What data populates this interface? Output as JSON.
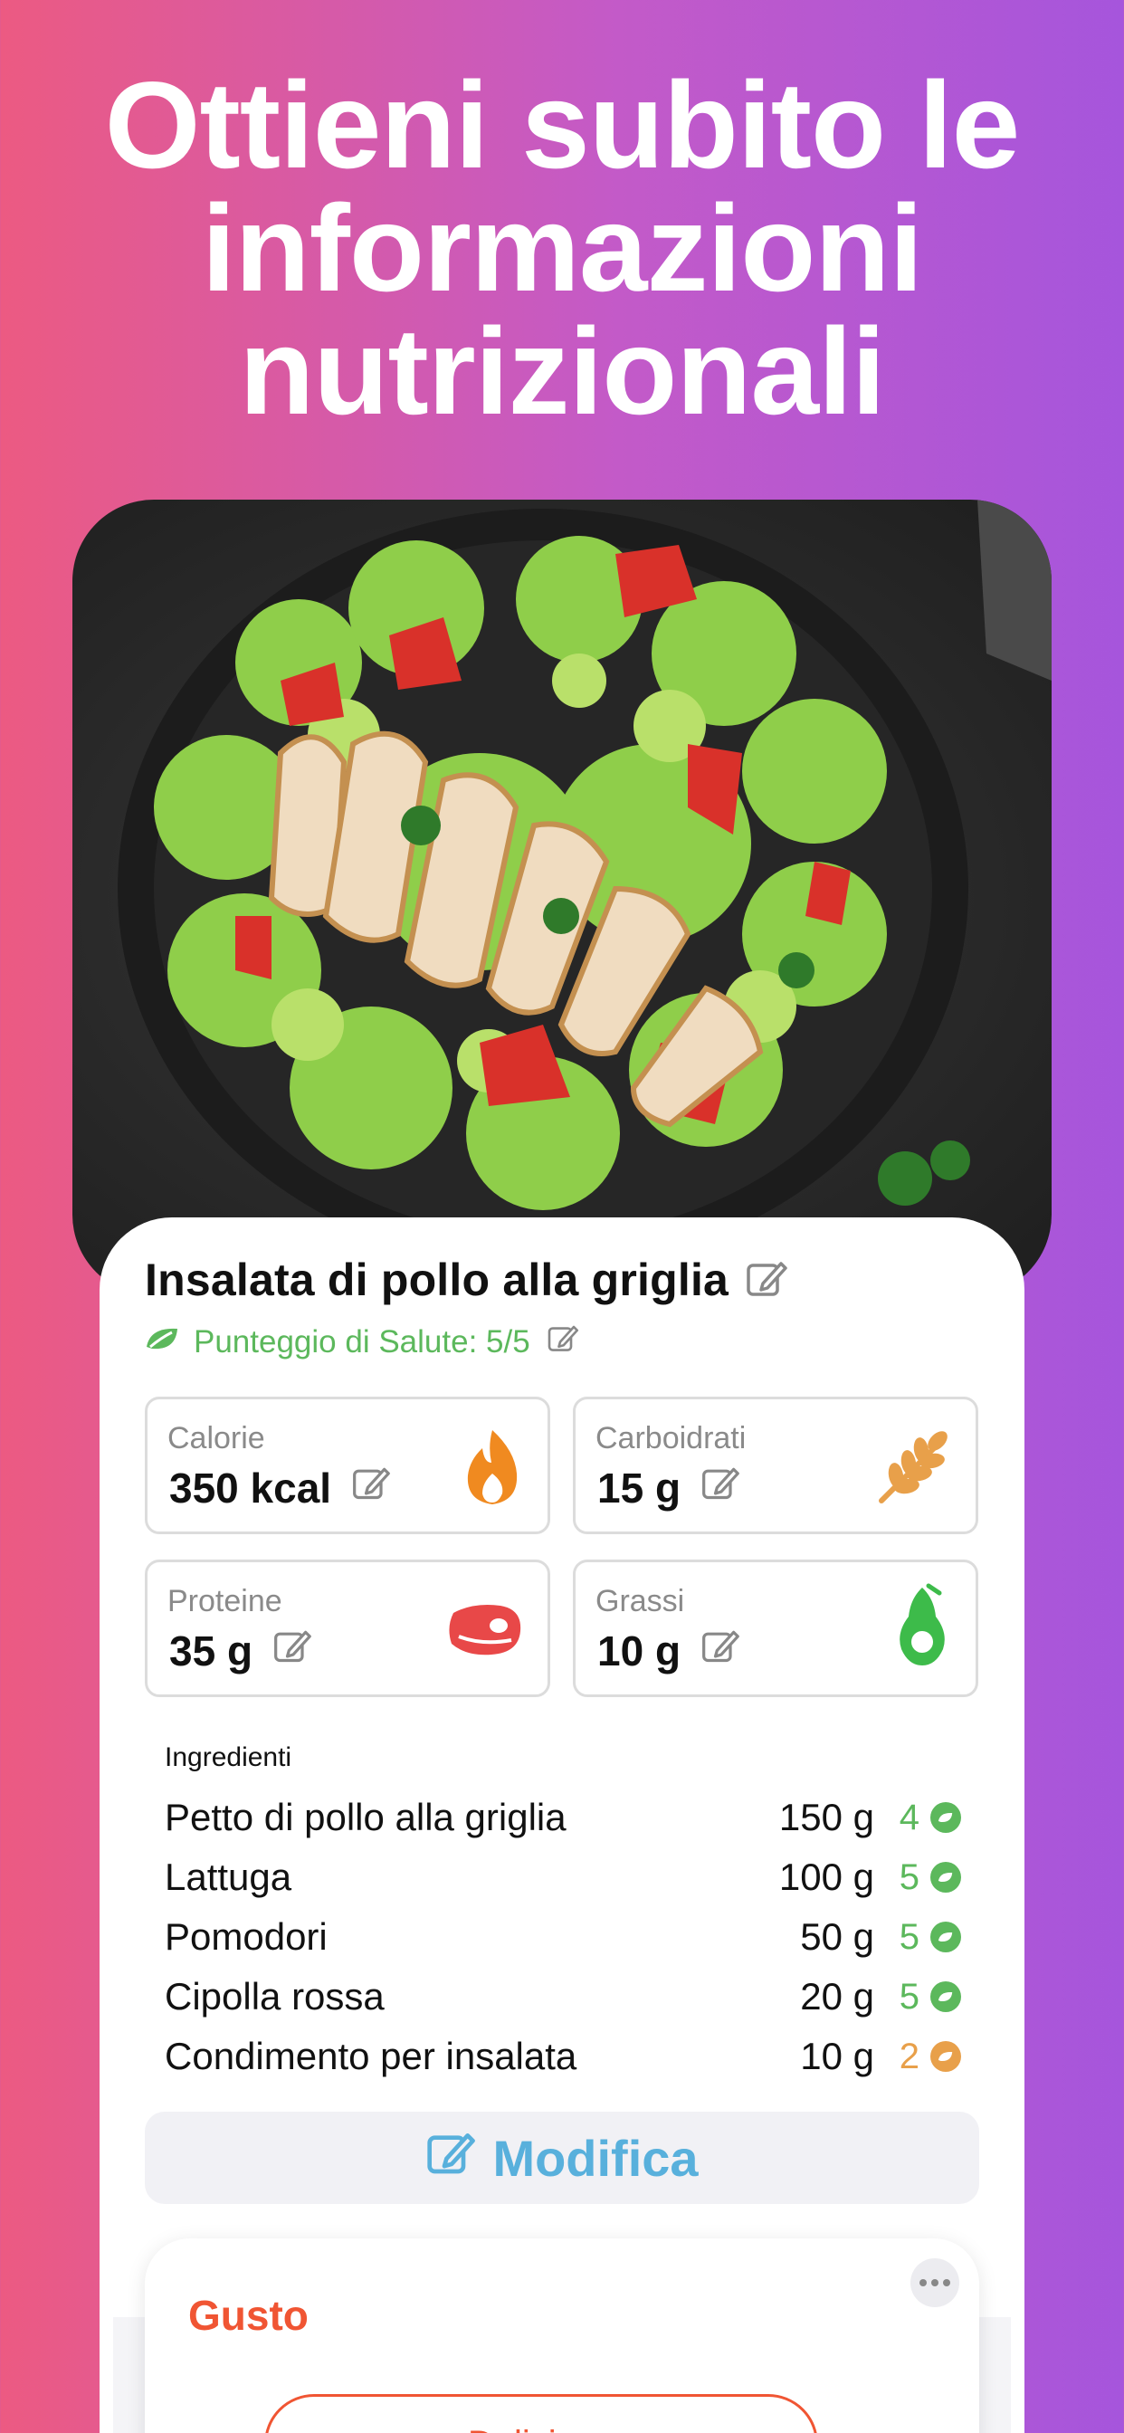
{
  "headline": {
    "line1": "Ottieni subito le",
    "line2": "informazioni",
    "line3": "nutrizionali"
  },
  "meal": {
    "title": "Insalata di pollo alla griglia",
    "health_score": "Punteggio di Salute: 5/5"
  },
  "nutrients": [
    {
      "label": "Calorie",
      "value": "350 kcal",
      "icon": "fire-icon"
    },
    {
      "label": "Carboidrati",
      "value": "15 g",
      "icon": "wheat-icon"
    },
    {
      "label": "Proteine",
      "value": "35 g",
      "icon": "steak-icon"
    },
    {
      "label": "Grassi",
      "value": "10 g",
      "icon": "avocado-icon"
    }
  ],
  "ingredients": {
    "title": "Ingredienti",
    "items": [
      {
        "name": "Petto di pollo alla griglia",
        "qty": "150 g",
        "score": "4",
        "color": "#5cb85c"
      },
      {
        "name": "Lattuga",
        "qty": "100 g",
        "score": "5",
        "color": "#5cb85c"
      },
      {
        "name": "Pomodori",
        "qty": "50 g",
        "score": "5",
        "color": "#5cb85c"
      },
      {
        "name": "Cipolla rossa",
        "qty": "20 g",
        "score": "5",
        "color": "#5cb85c"
      },
      {
        "name": "Condimento per insalata",
        "qty": "10 g",
        "score": "2",
        "color": "#e8a04a"
      }
    ]
  },
  "edit_button": "Modifica",
  "taste": {
    "title": "Gusto",
    "option": "Delizioso"
  },
  "colors": {
    "accent_green": "#5cb85c",
    "accent_blue": "#58b0dc",
    "accent_orange": "#f05533",
    "bg_gradient_start": "#ec5a82",
    "bg_gradient_end": "#a655dc"
  }
}
